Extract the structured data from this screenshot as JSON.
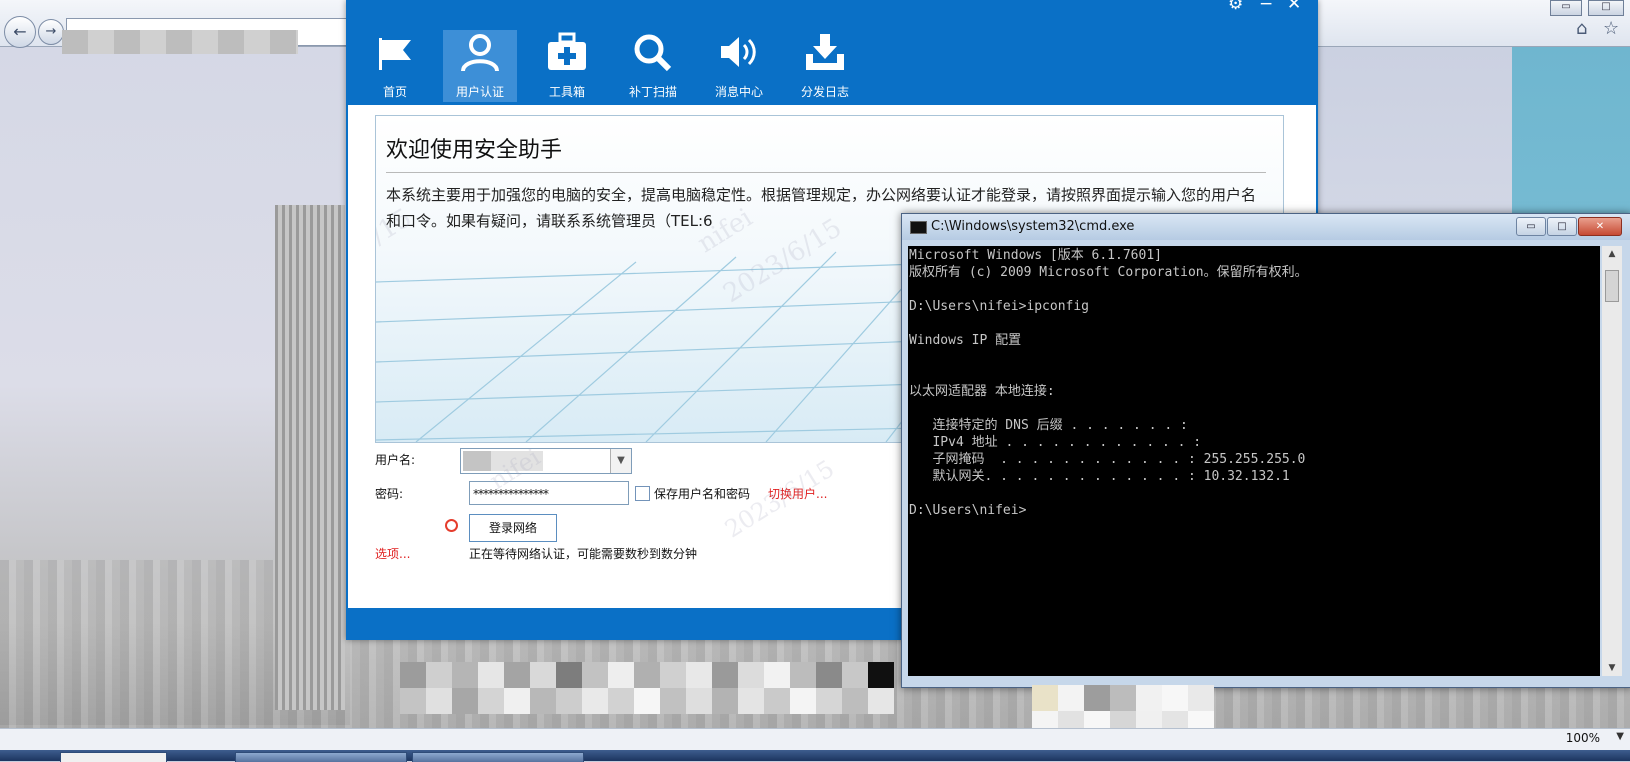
{
  "security_app": {
    "toolbar": [
      {
        "label": "首页"
      },
      {
        "label": "用户认证"
      },
      {
        "label": "工具箱"
      },
      {
        "label": "补丁扫描"
      },
      {
        "label": "消息中心"
      },
      {
        "label": "分发日志"
      }
    ],
    "active_tab": "用户认证",
    "banner": {
      "title": "欢迎使用安全助手",
      "text": "本系统主要用于加强您的电脑的安全，提高电脑稳定性。根据管理规定，办公网络要认证才能登录，请按照界面提示输入您的用户名和口令。如果有疑问，请联系系统管理员（TEL:6"
    },
    "watermarks": [
      "nifei",
      "2023/6/15",
      "nifei",
      "2023/6/15",
      "nifei",
      "2023/6/15",
      "nifei",
      "2023/6/15"
    ],
    "form": {
      "username_label": "用户名:",
      "password_label": "密码:",
      "password_value": "***************",
      "save_label": "保存用户名和密码",
      "switch_user": "切换用户...",
      "login_button": "登录网络",
      "options": "选项...",
      "status": "正在等待网络认证，可能需要数秒到数分钟"
    },
    "window_controls": [
      "⚙",
      "−",
      "✕"
    ]
  },
  "cmd": {
    "title": "C:\\Windows\\system32\\cmd.exe",
    "lines": [
      "Microsoft Windows [版本 6.1.7601]",
      "版权所有 (c) 2009 Microsoft Corporation。保留所有权利。",
      "",
      "D:\\Users\\nifei>ipconfig",
      "",
      "Windows IP 配置",
      "",
      "",
      "以太网适配器 本地连接:",
      "",
      "   连接特定的 DNS 后缀 . . . . . . . :",
      "   IPv4 地址 . . . . . . . . . . . . :",
      "   子网掩码  . . . . . . . . . . . . : 255.255.255.0",
      "   默认网关. . . . . . . . . . . . . : 10.32.132.1",
      "",
      "D:\\Users\\nifei>"
    ],
    "controls": [
      "▭",
      "□",
      "✕"
    ]
  },
  "browser": {
    "zoom": "100%",
    "back_icon": "←",
    "forward_icon": "→",
    "home_icon": "⌂",
    "favorites_icon": "☆"
  },
  "colors": {
    "accent": "#0a70c6",
    "active_tab": "#3d8fd7",
    "link_red": "#e02020",
    "console_bg": "#000000"
  }
}
